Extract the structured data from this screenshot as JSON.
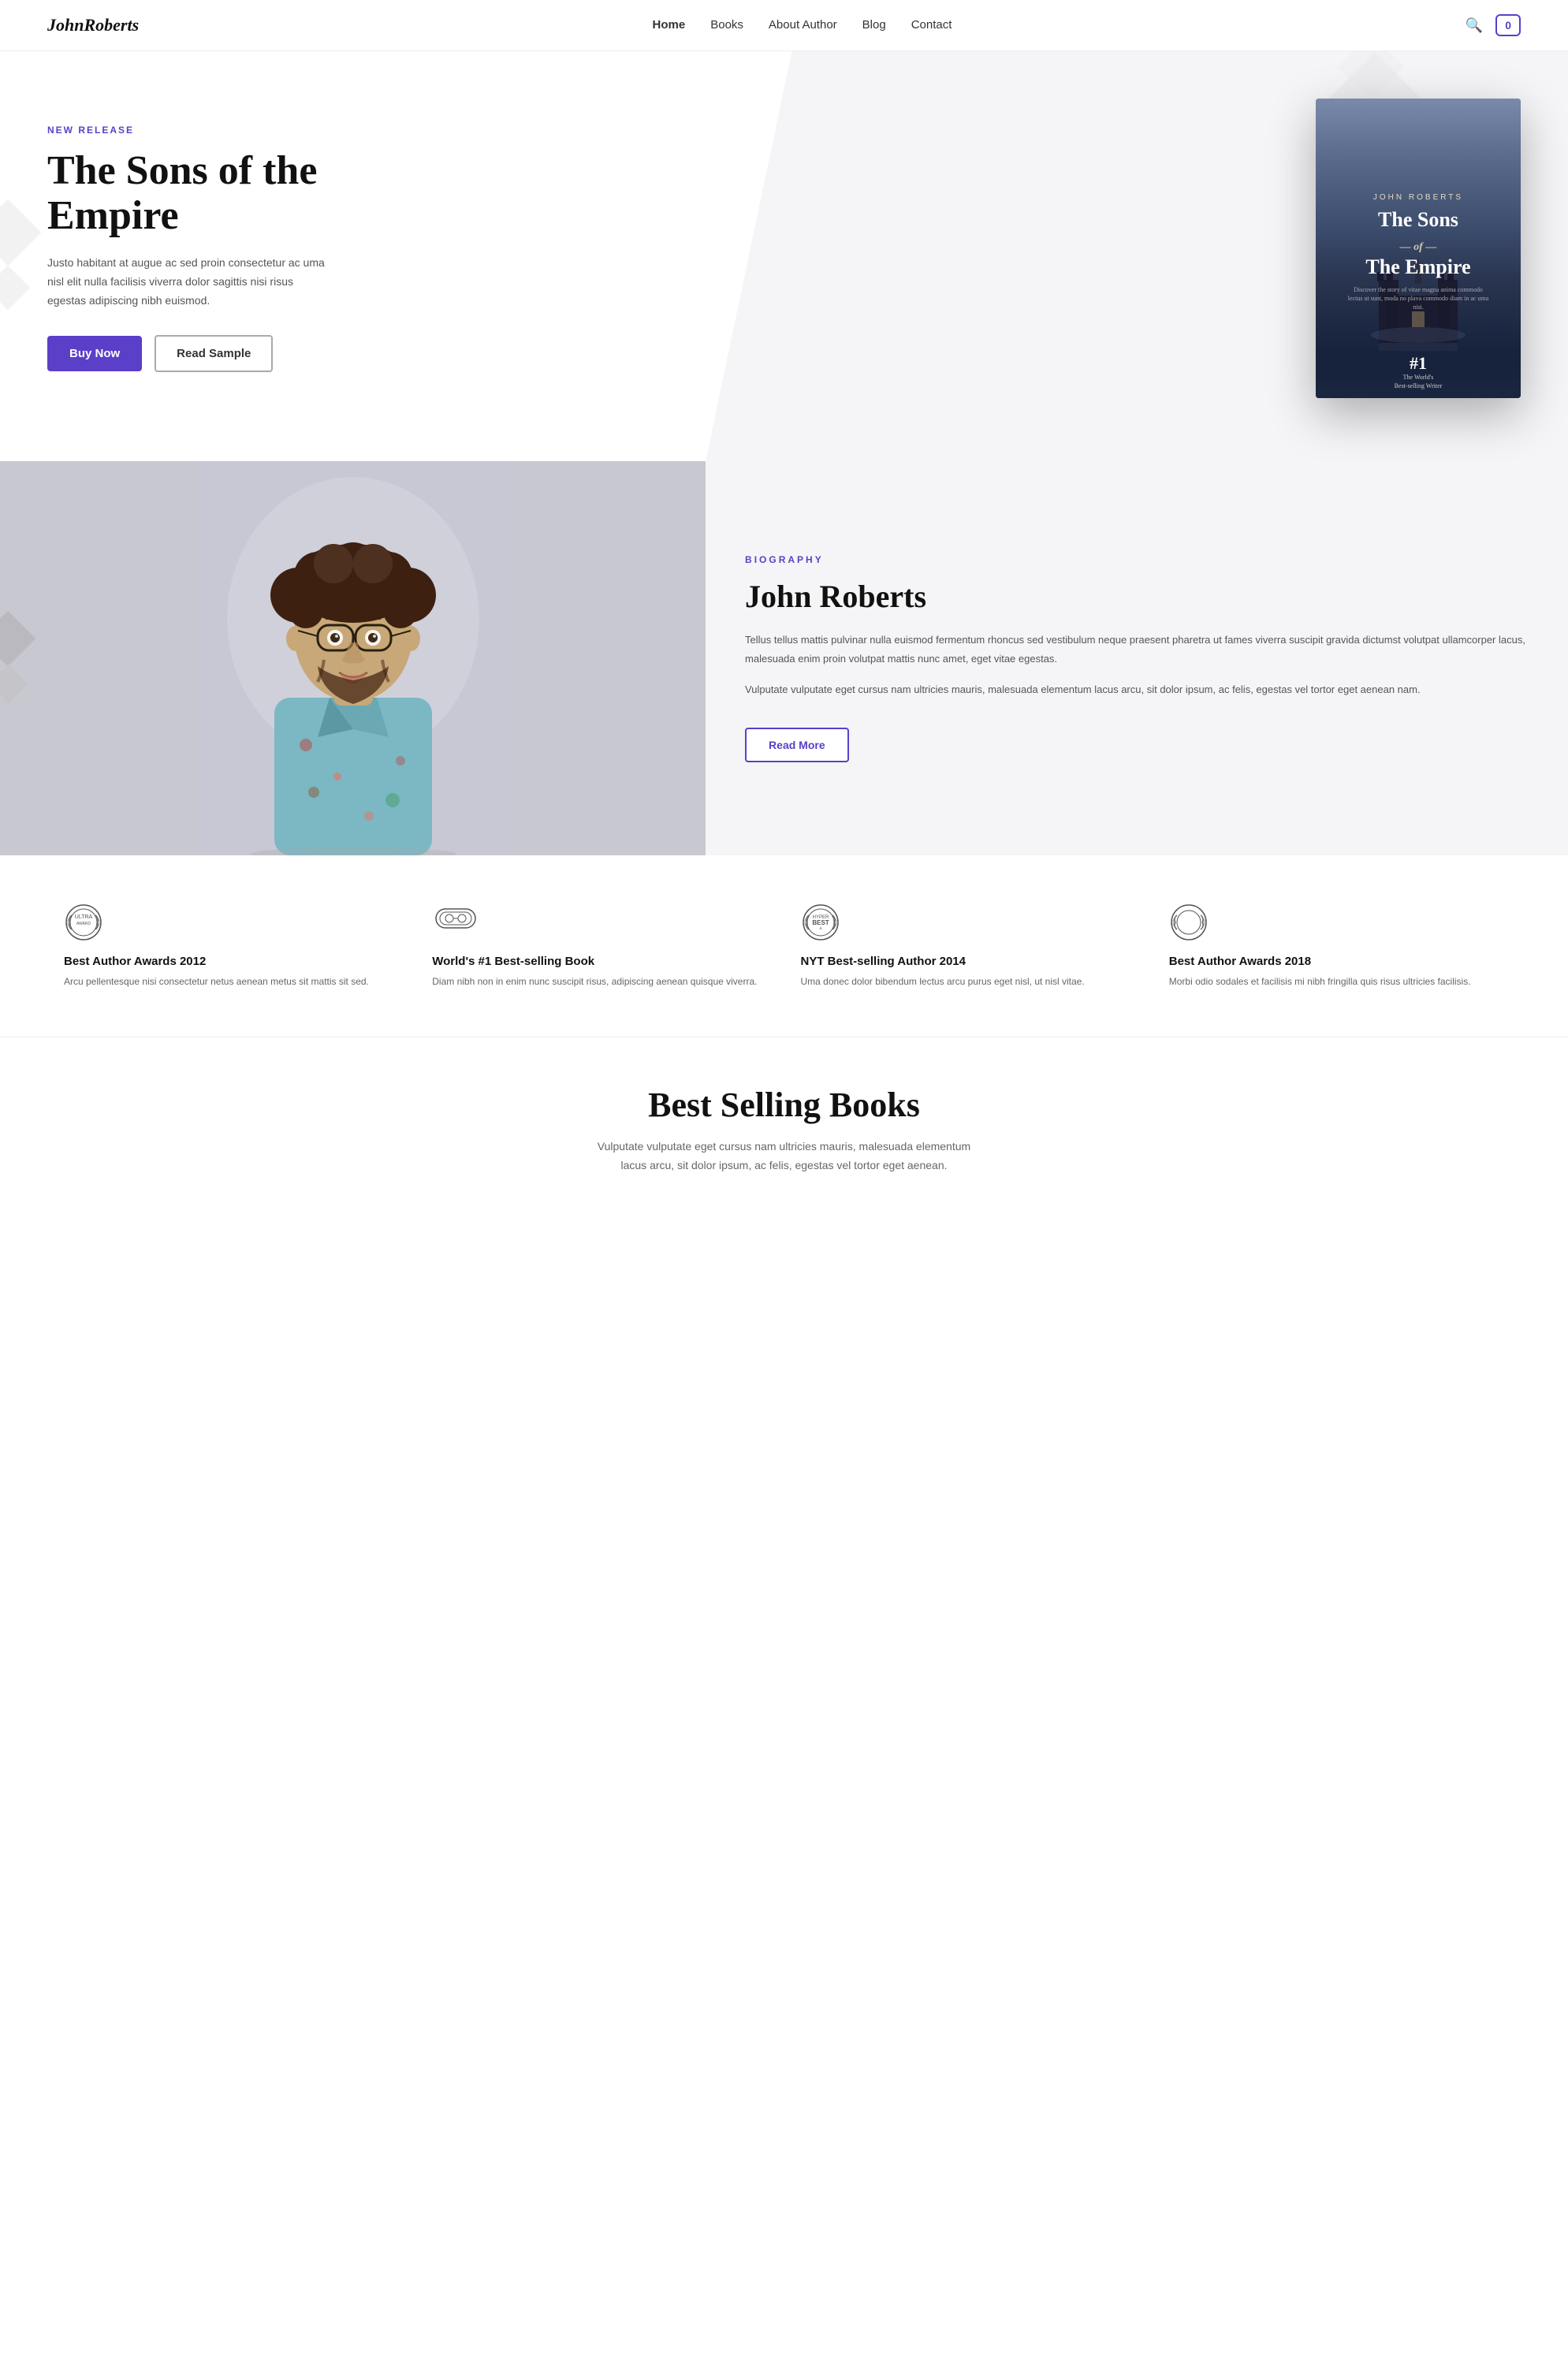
{
  "site": {
    "logo": "JohnRoberts"
  },
  "nav": {
    "links": [
      {
        "label": "Home",
        "active": true
      },
      {
        "label": "Books",
        "active": false
      },
      {
        "label": "About Author",
        "active": false
      },
      {
        "label": "Blog",
        "active": false
      },
      {
        "label": "Contact",
        "active": false
      }
    ],
    "cart_count": "0",
    "search_aria": "Search"
  },
  "hero": {
    "badge": "NEW RELEASE",
    "title": "The Sons of the Empire",
    "description": "Justo habitant at augue ac sed proin consectetur ac uma nisl elit nulla facilisis viverra dolor sagittis nisi risus egestas adipiscing nibh euismod.",
    "buy_button": "Buy Now",
    "sample_button": "Read Sample",
    "book_author": "JOHN ROBERTS",
    "book_title_line1": "The Sons",
    "book_title_of": "— of —",
    "book_title_line2": "The Empire",
    "book_small_text": "Discover the story of vitae magna anima commodo lectus ut sunt, moda no plava commodo diam in ac uma nisi.",
    "book_rank": "#1",
    "book_rank_desc_line1": "The World's",
    "book_rank_desc_line2": "Best-selling Writer"
  },
  "biography": {
    "label": "BIOGRAPHY",
    "name": "John Roberts",
    "paragraph1": "Tellus tellus mattis pulvinar nulla euismod fermentum rhoncus sed vestibulum neque praesent pharetra ut fames viverra suscipit gravida dictumst volutpat ullamcorper lacus, malesuada enim proin volutpat mattis nunc amet, eget vitae egestas.",
    "paragraph2": "Vulputate vulputate eget cursus nam ultricies mauris, malesuada elementum lacus arcu, sit dolor ipsum, ac felis, egestas vel tortor eget aenean nam.",
    "read_more_button": "Read More"
  },
  "awards": [
    {
      "title": "Best Author Awards 2012",
      "desc": "Arcu pellentesque nisi consectetur netus aenean metus sit mattis sit sed."
    },
    {
      "title": "World's #1 Best-selling Book",
      "desc": "Diam nibh non in enim nunc suscipit risus, adipiscing aenean quisque viverra."
    },
    {
      "title": "NYT Best-selling Author 2014",
      "desc": "Uma donec dolor bibendum lectus arcu purus eget nisl, ut nisl vitae."
    },
    {
      "title": "Best Author Awards 2018",
      "desc": "Morbi odio sodales et facilisis mi nibh fringilla quis risus ultricies facilisis."
    }
  ],
  "bestselling": {
    "title": "Best Selling Books",
    "description": "Vulputate vulputate eget cursus nam ultricies mauris, malesuada elementum lacus arcu, sit dolor ipsum, ac felis, egestas vel tortor eget aenean."
  }
}
